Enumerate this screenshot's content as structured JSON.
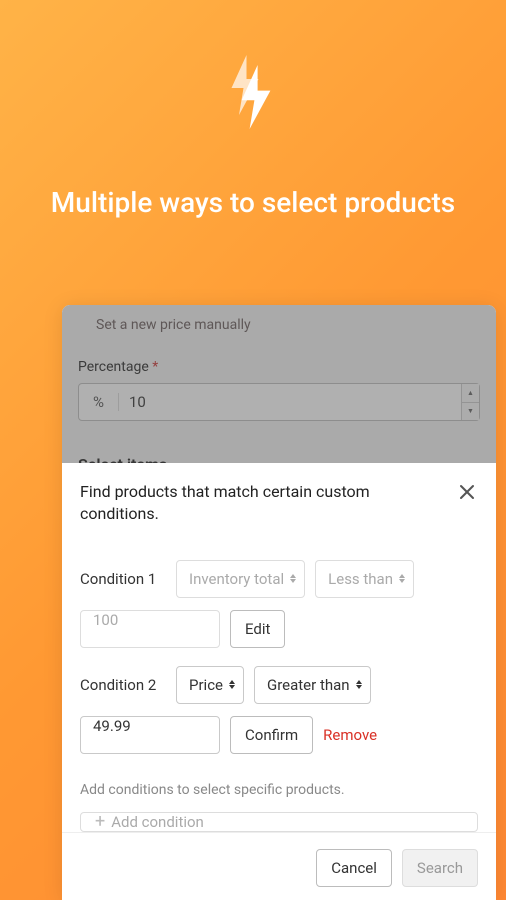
{
  "header": {
    "title": "Multiple ways to select products"
  },
  "dimmed": {
    "manual_label": "Set a new price manually",
    "percentage_label": "Percentage",
    "required_mark": "*",
    "prefix": "%",
    "value": "10",
    "select_items_hint": "Select items"
  },
  "modal": {
    "title": "Find products that match certain custom conditions.",
    "conditions": [
      {
        "label": "Condition 1",
        "field": "Inventory total",
        "operator": "Less than",
        "value": "100",
        "action_label": "Edit",
        "editable": false
      },
      {
        "label": "Condition 2",
        "field": "Price",
        "operator": "Greater than",
        "value": "49.99",
        "action_label": "Confirm",
        "remove_label": "Remove",
        "editable": true
      }
    ],
    "helper_text": "Add conditions to select specific products.",
    "add_condition_label": "Add condition",
    "footer": {
      "cancel_label": "Cancel",
      "search_label": "Search"
    }
  }
}
